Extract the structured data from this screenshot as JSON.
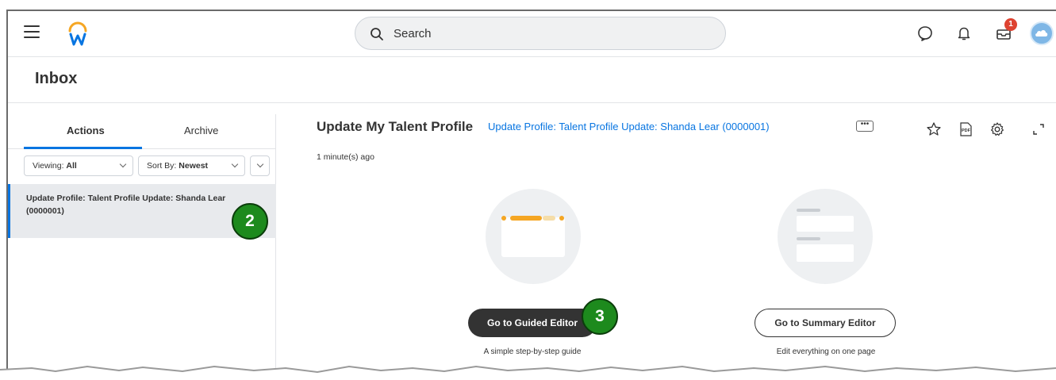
{
  "topbar": {
    "search_placeholder": "Search",
    "notification_count": "1",
    "icons": [
      "menu-icon",
      "workday-logo",
      "search-icon",
      "chat-icon",
      "bell-icon",
      "inbox-tray-icon",
      "cloud-avatar"
    ]
  },
  "page": {
    "title": "Inbox"
  },
  "left": {
    "tabs": [
      {
        "label": "Actions",
        "active": true
      },
      {
        "label": "Archive",
        "active": false
      }
    ],
    "viewing": {
      "prefix": "Viewing:",
      "value": "All"
    },
    "sort": {
      "prefix": "Sort By:",
      "value": "Newest"
    },
    "items": [
      {
        "label": "Update Profile: Talent Profile Update: Shanda Lear (0000001)"
      }
    ]
  },
  "main": {
    "task_title": "Update My Talent Profile",
    "task_link": "Update Profile: Talent Profile Update: Shanda Lear (0000001)",
    "time": "1 minute(s) ago",
    "options": [
      {
        "button": "Go to Guided Editor",
        "caption": "A simple step-by-step guide"
      },
      {
        "button": "Go to Summary Editor",
        "caption": "Edit everything on one page"
      }
    ]
  },
  "annotations": {
    "step_2": "2",
    "step_3": "3"
  },
  "colors": {
    "accent": "#0875e1",
    "badge": "#de4331",
    "step_marker": "#1d8a1d",
    "dark_button": "#333333",
    "logo_orange": "#f5a623"
  }
}
